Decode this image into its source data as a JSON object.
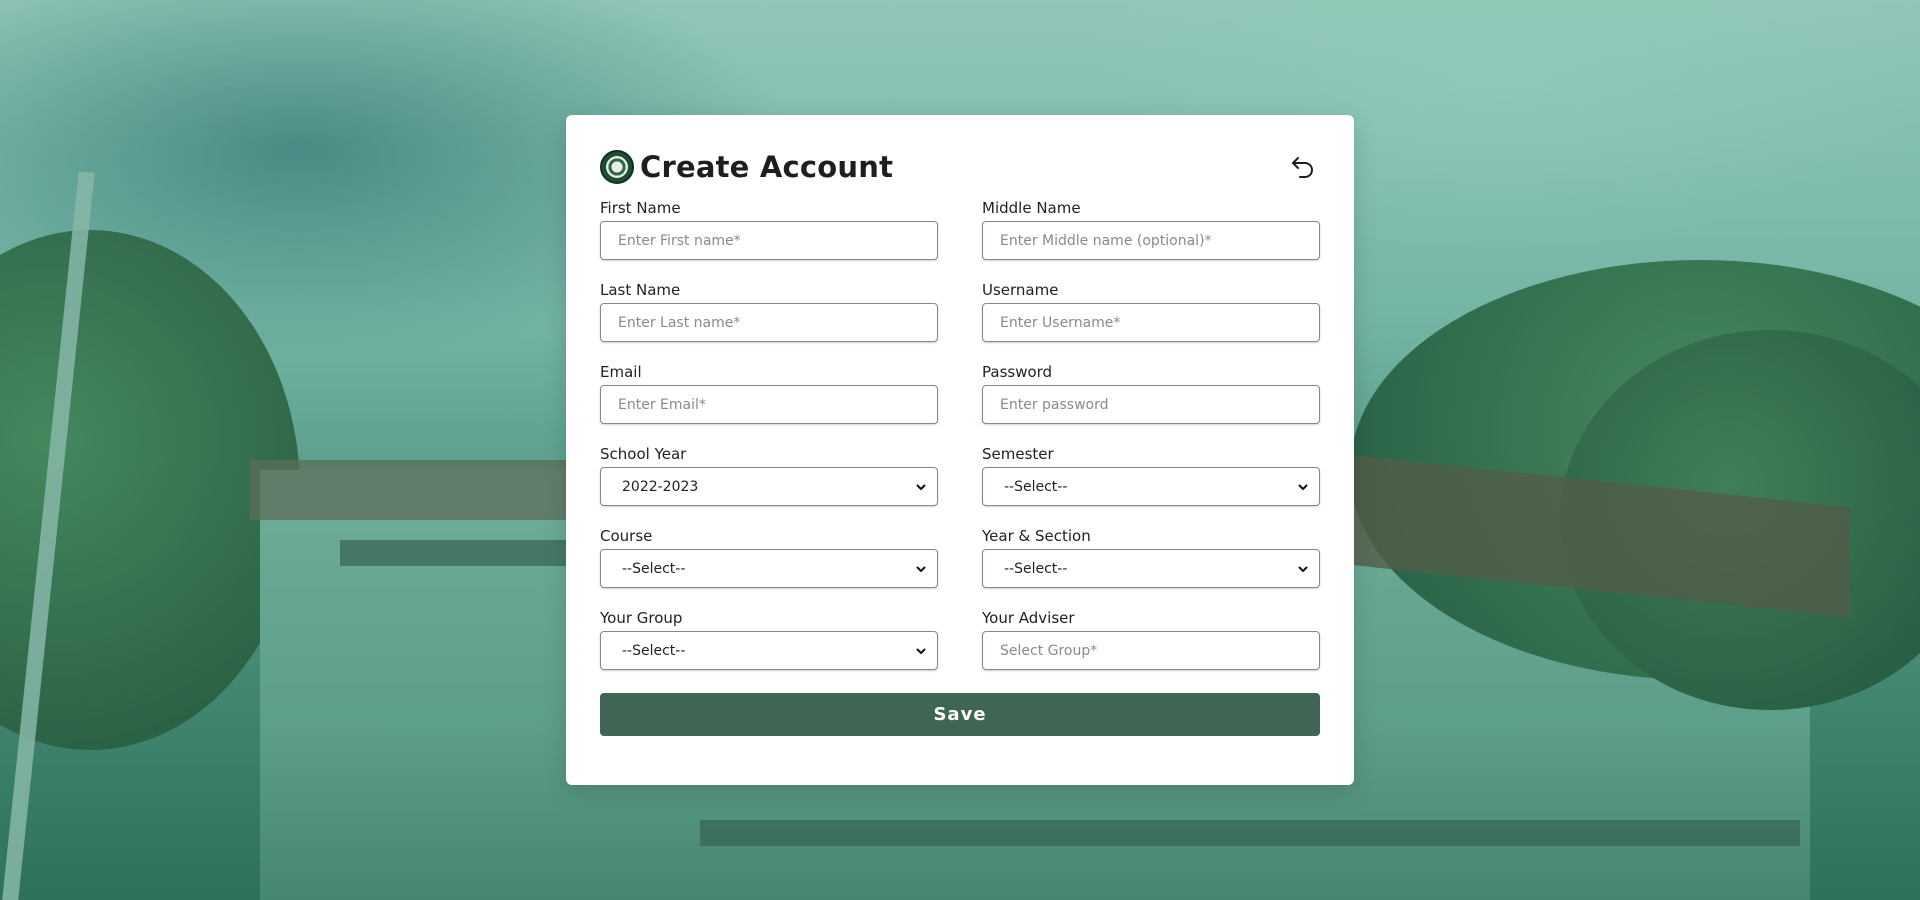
{
  "form": {
    "title": "Create Account",
    "fields": {
      "first_name": {
        "label": "First Name",
        "placeholder": "Enter First name*"
      },
      "middle_name": {
        "label": "Middle Name",
        "placeholder": "Enter Middle name (optional)*"
      },
      "last_name": {
        "label": "Last Name",
        "placeholder": "Enter Last name*"
      },
      "username": {
        "label": "Username",
        "placeholder": "Enter Username*"
      },
      "email": {
        "label": "Email",
        "placeholder": "Enter Email*"
      },
      "password": {
        "label": "Password",
        "placeholder": "Enter password"
      },
      "school_year": {
        "label": "School Year",
        "value": "2022-2023"
      },
      "semester": {
        "label": "Semester",
        "value": "--Select--"
      },
      "course": {
        "label": "Course",
        "value": "--Select--"
      },
      "year_section": {
        "label": "Year & Section",
        "value": "--Select--"
      },
      "group": {
        "label": "Your Group",
        "value": "--Select--"
      },
      "adviser": {
        "label": "Your Adviser",
        "placeholder": "Select Group*"
      }
    },
    "save_label": "Save"
  },
  "icons": {
    "logo": "school-seal-icon",
    "back": "undo-arrow-icon",
    "dropdown": "chevron-down-icon"
  },
  "colors": {
    "accent": "#3f6655",
    "card": "#ffffff",
    "input_border": "#7e8e86"
  }
}
